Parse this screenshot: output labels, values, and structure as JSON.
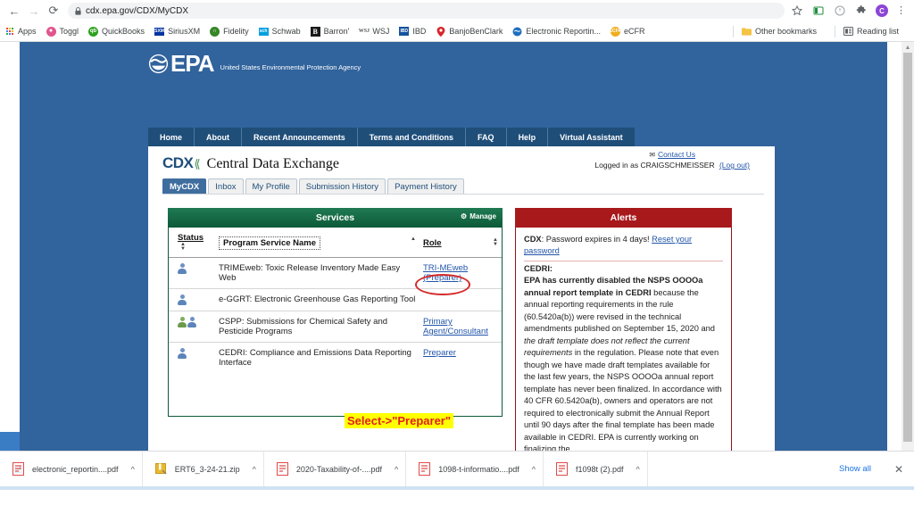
{
  "browser": {
    "back_icon": "back-arrow-icon",
    "forward_icon": "forward-arrow-icon",
    "reload_icon": "reload-icon",
    "url": "cdx.epa.gov/CDX/MyCDX",
    "lock_icon": "lock-icon",
    "star_icon": "bookmark-star-icon",
    "profile_initial": "C",
    "menu_icon": "kebab-menu-icon"
  },
  "bookmarks": {
    "items": [
      {
        "label": "Apps",
        "icon": "apps-grid-icon",
        "color": "#e8a33d"
      },
      {
        "label": "Toggl",
        "icon": "toggl-icon",
        "color": "#e0568f"
      },
      {
        "label": "QuickBooks",
        "icon": "quickbooks-icon",
        "color": "#2ca01c"
      },
      {
        "label": "SiriusXM",
        "icon": "siriusxm-icon",
        "color": "#0033a0"
      },
      {
        "label": "Fidelity",
        "icon": "fidelity-icon",
        "color": "#368727"
      },
      {
        "label": "Schwab",
        "icon": "schwab-icon",
        "color": "#00a0df"
      },
      {
        "label": "Barron'",
        "icon": "barrons-icon",
        "color": "#1a1a1a"
      },
      {
        "label": "WSJ",
        "icon": "wsj-icon",
        "color": "#555555"
      },
      {
        "label": "IBD",
        "icon": "ibd-icon",
        "color": "#1552a0"
      },
      {
        "label": "BanjoBenClark",
        "icon": "banjobenclark-pin-icon",
        "color": "#d6252b"
      },
      {
        "label": "Electronic Reportin...",
        "icon": "epa-icon",
        "color": "#1f6fbf"
      },
      {
        "label": "eCFR",
        "icon": "ecfr-icon",
        "color": "#f0ad20"
      }
    ],
    "other_bookmarks": "Other bookmarks",
    "other_bookmarks_icon": "folder-icon",
    "reading_list": "Reading list",
    "reading_list_icon": "reading-list-icon"
  },
  "epa": {
    "logo_text": "EPA",
    "logo_mark": "epa-seal-icon",
    "tagline": "United States Environmental Protection Agency",
    "nav": [
      "Home",
      "About",
      "Recent Announcements",
      "Terms and Conditions",
      "FAQ",
      "Help",
      "Virtual Assistant"
    ]
  },
  "cdx": {
    "logo": "CDX",
    "logo_leaf_icon": "leaf-icon",
    "title": "Central Data Exchange",
    "contact_us": "Contact Us",
    "contact_icon": "envelope-icon",
    "logged_in_prefix": "Logged in as CRAIGSCHMEISSER",
    "logout": "(Log out)",
    "tabs": [
      {
        "label": "MyCDX",
        "active": true
      },
      {
        "label": "Inbox",
        "active": false
      },
      {
        "label": "My Profile",
        "active": false
      },
      {
        "label": "Submission History",
        "active": false
      },
      {
        "label": "Payment History",
        "active": false
      }
    ]
  },
  "services": {
    "panel_title": "Services",
    "manage_label": "Manage",
    "manage_icon": "gear-icon",
    "columns": [
      "Status",
      "Program Service Name",
      "Role"
    ],
    "rows": [
      {
        "status_icons": [
          "person-blue-icon"
        ],
        "name": "TRIMEweb: Toxic Release Inventory Made Easy Web",
        "role": "TRI-MEweb (Preparer)",
        "circled": false
      },
      {
        "status_icons": [
          "person-blue-icon"
        ],
        "name": "e-GGRT: Electronic Greenhouse Gas Reporting Tool",
        "role": "",
        "circled": false
      },
      {
        "status_icons": [
          "person-green-icon",
          "person-blue-icon"
        ],
        "name": "CSPP: Submissions for Chemical Safety and Pesticide Programs",
        "role": "Primary Agent/Consultant",
        "circled": false
      },
      {
        "status_icons": [
          "person-blue-icon"
        ],
        "name": "CEDRI: Compliance and Emissions Data Reporting Interface",
        "role": "Preparer",
        "circled": true
      }
    ]
  },
  "alerts": {
    "panel_title": "Alerts",
    "cdx_label": "CDX",
    "cdx_message": ": Password expires in 4 days! ",
    "reset_link": "Reset your password",
    "cedri_label": "CEDRI:",
    "body_bold_1": "EPA has currently disabled the NSPS OOOOa annual report template in CEDRI",
    "body_text_1": " because the annual reporting requirements in the rule (60.5420a(b)) were revised in the technical amendments published on September 15, 2020 and ",
    "body_italic_1": "the draft template does not reflect the current requirements",
    "body_text_2": " in the regulation. Please note that even though we have made draft templates available for the last few years, the NSPS OOOOa annual report template has never been finalized. In accordance with 40 CFR 60.5420a(b), owners and operators are not required to electronically submit the Annual Report until 90 days after the final template has been made available in CEDRI. EPA is currently working on finalizing the"
  },
  "annotation": {
    "text": "Select->\"Preparer\""
  },
  "downloads": {
    "items": [
      {
        "name": "electronic_reportin....pdf",
        "icon": "pdf-file-icon",
        "caret": "chevron-up-icon"
      },
      {
        "name": "ERT6_3-24-21.zip",
        "icon": "zip-file-icon",
        "caret": "chevron-up-icon"
      },
      {
        "name": "2020-Taxability-of-....pdf",
        "icon": "pdf-file-icon",
        "caret": "chevron-up-icon"
      },
      {
        "name": "1098-t-informatio....pdf",
        "icon": "pdf-file-icon",
        "caret": "chevron-up-icon"
      },
      {
        "name": "f1098t (2).pdf",
        "icon": "pdf-file-icon",
        "caret": "chevron-up-icon"
      }
    ],
    "show_all": "Show all",
    "close_icon": "close-icon"
  },
  "colors": {
    "page_blue": "#31639c",
    "services_green": "#0d5a38",
    "alerts_red": "#a8191b",
    "link_blue": "#2255aa",
    "annotation_bg": "#ffff00",
    "annotation_fg": "#e02020",
    "circle_red": "#d42a2a"
  }
}
